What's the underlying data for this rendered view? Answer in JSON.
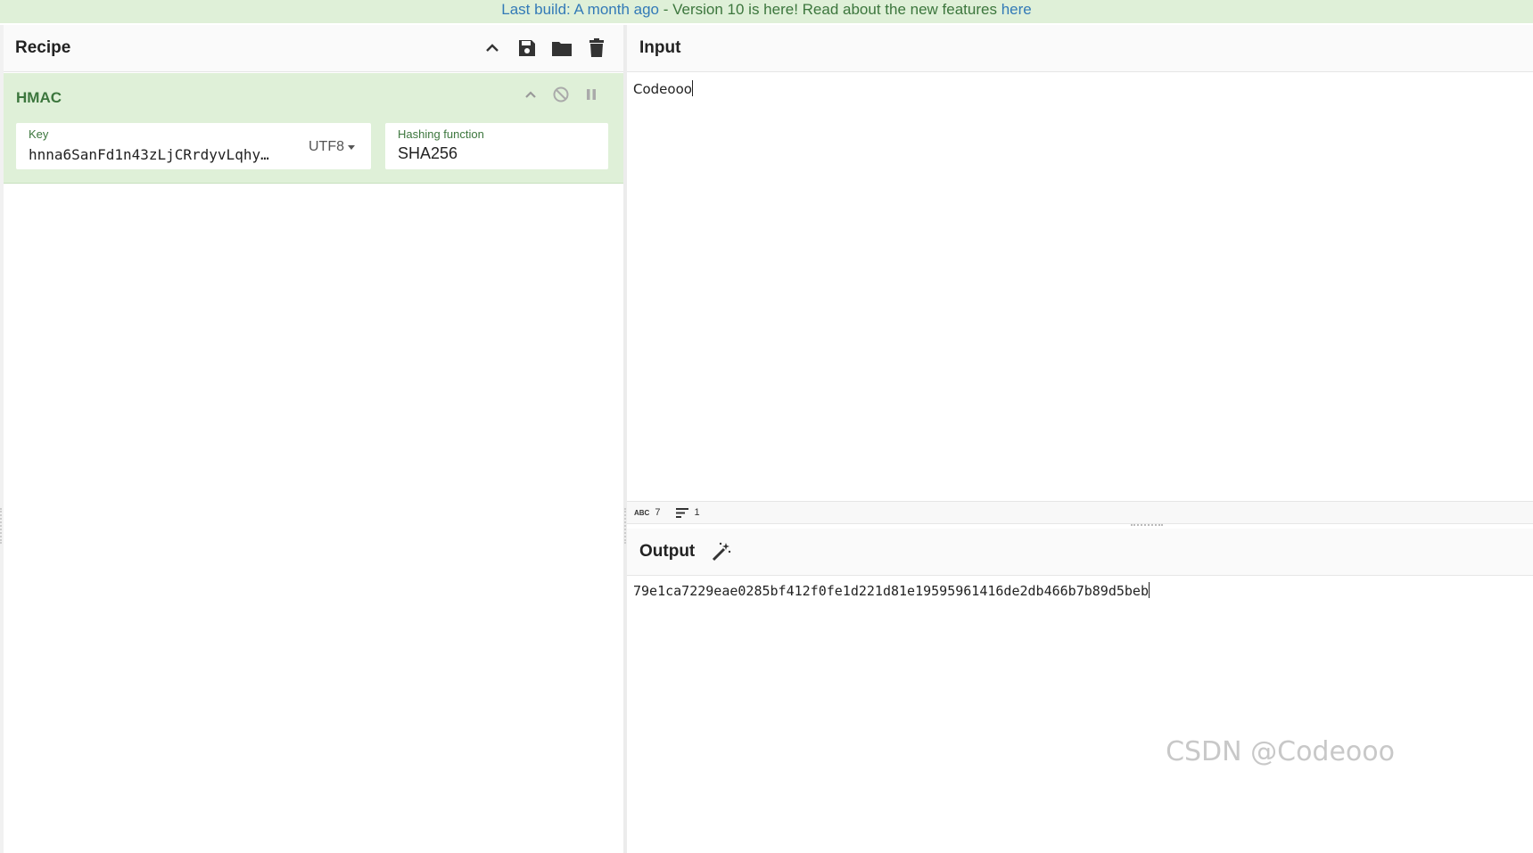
{
  "banner": {
    "part1": "Last build: A month ago",
    "part2": " - Version 10 is here! Read about the new features ",
    "part3": "here"
  },
  "recipe": {
    "title": "Recipe",
    "icons": [
      "chevron-up-icon",
      "save-icon",
      "folder-icon",
      "trash-icon"
    ],
    "operation": {
      "name": "HMAC",
      "key_label": "Key",
      "key_value": "hnna6SanFd1n43zLjCRrdyvLqhy…",
      "key_encoding": "UTF8",
      "hash_label": "Hashing function",
      "hash_value": "SHA256"
    }
  },
  "input": {
    "title": "Input",
    "value": "Codeooo",
    "status": {
      "chars": "7",
      "lines": "1"
    }
  },
  "output": {
    "title": "Output",
    "value": "79e1ca7229eae0285bf412f0fe1d221d81e19595961416de2db466b7b89d5beb"
  },
  "watermark": "CSDN @Codeooo",
  "colors": {
    "banner_bg": "#dff0d8",
    "op_bg": "#dff0d8",
    "op_text": "#3c763d",
    "link": "#337ab7"
  }
}
